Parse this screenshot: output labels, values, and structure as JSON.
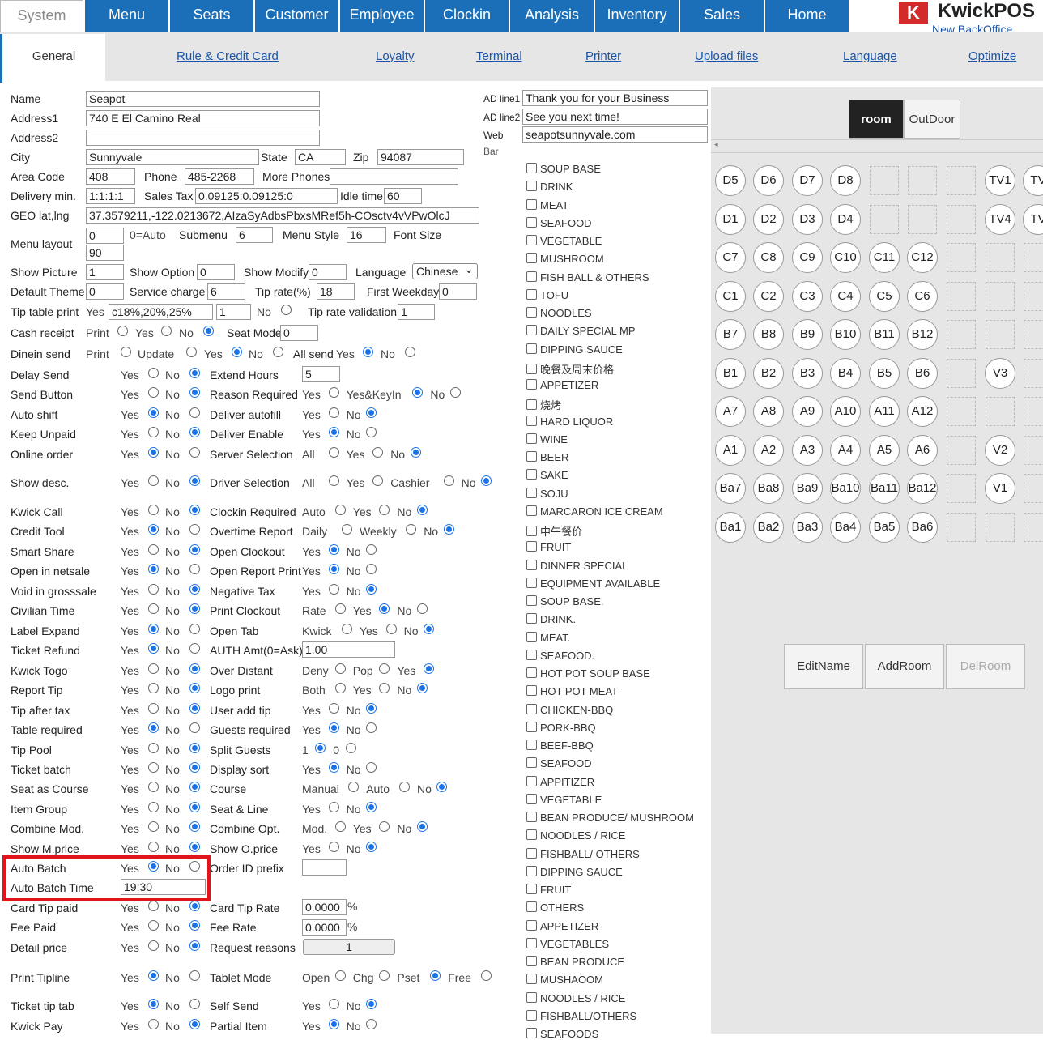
{
  "nav": {
    "system": "System",
    "items": [
      "Menu",
      "Seats",
      "Customer",
      "Employee",
      "Clockin",
      "Analysis",
      "Inventory",
      "Sales",
      "Home"
    ],
    "brand": "KwickPOS",
    "backoffice": "New BackOffice"
  },
  "subnav": {
    "general": "General",
    "links": [
      "Rule & Credit Card",
      "Loyalty",
      "Terminal",
      "Printer",
      "Upload files",
      "Language",
      "Optimize"
    ]
  },
  "form": {
    "name_l": "Name",
    "name_v": "Seapot",
    "addr1_l": "Address1",
    "addr1_v": "740 E El Camino Real",
    "addr2_l": "Address2",
    "addr2_v": "",
    "city_l": "City",
    "city_v": "Sunnyvale",
    "state_l": "State",
    "state_v": "CA",
    "zip_l": "Zip",
    "zip_v": "94087",
    "area_l": "Area Code",
    "area_v": "408",
    "phone_l": "Phone",
    "phone_v": "485-2268",
    "more_l": "More Phones",
    "more_v": "",
    "delivery_l": "Delivery min.",
    "delivery_v": "1:1:1:1",
    "tax_l": "Sales Tax",
    "tax_v": "0.09125:0.09125:0",
    "idle_l": "Idle time",
    "idle_v": "60",
    "geo_l": "GEO lat,lng",
    "geo_v": "37.3579211,-122.0213672,AIzaSyAdbsPbxsMRef5h-COsctv4vVPwOlcJ",
    "menulayout_l": "Menu layout",
    "menulayout_v1": "0",
    "menulayout_t": "0=Auto",
    "menulayout_v2": "90",
    "submenu_l": "Submenu",
    "submenu_v": "6",
    "menustyle_l": "Menu Style",
    "menustyle_v": "16",
    "fontsize_l": "Font Size",
    "showpic_l": "Show Picture",
    "showpic_v": "1",
    "showopt_l": "Show Option",
    "showopt_v": "0",
    "showmod_l": "Show Modify",
    "showmod_v": "0",
    "lang_l": "Language",
    "lang_v": "Chinese",
    "theme_l": "Default Theme",
    "theme_v": "0",
    "svc_l": "Service charge",
    "svc_v": "6",
    "tiprate_l": "Tip rate(%)",
    "tiprate_v": "18",
    "firstwd_l": "First Weekday",
    "firstwd_v": "0",
    "tiptable_l": "Tip table print",
    "tiptable_yes": "Yes",
    "tiptable_v": "c18%,20%,25%",
    "tiptable_v2": "1",
    "tiptable_no": "No",
    "tipval_l": "Tip rate validation",
    "tipval_v": "1",
    "cash_l": "Cash receipt",
    "cash_t1": "Print",
    "cash_t2": "Yes",
    "cash_t3": "No",
    "seatmode_l": "Seat Mode",
    "seatmode_v": "0",
    "dinein_l": "Dinein send",
    "dinein_t1": "Print",
    "dinein_t2": "Update",
    "dinein_t3": "Yes",
    "dinein_t4": "No",
    "allsend_l": "All send",
    "allsend_yes": "Yes",
    "allsend_no": "No",
    "extend_v": "5",
    "authamt_v": "1.00",
    "cardtip_v": "0.0000",
    "feerate_v": "0.0000",
    "pct": "%",
    "reqreason_v": "1",
    "autobatch_v": "19:30",
    "orderid_v": ""
  },
  "rows": [
    {
      "l": "Delay Send",
      "r": "Extend Hours"
    },
    {
      "l": "Send Button",
      "r": "Reason Required",
      "o": [
        "Yes",
        "Yes&KeyIn",
        "No"
      ]
    },
    {
      "l": "Auto shift",
      "r": "Deliver autofill",
      "o": [
        "Yes",
        "No"
      ]
    },
    {
      "l": "Keep Unpaid",
      "r": "Deliver Enable",
      "o": [
        "Yes",
        "No"
      ]
    },
    {
      "l": "Online order",
      "r": "Server Selection",
      "o": [
        "All",
        "Yes",
        "No"
      ]
    },
    {
      "l": "Show desc.",
      "r": "Driver Selection",
      "o": [
        "All",
        "Yes",
        "Cashier",
        "No"
      ]
    },
    {
      "l": "Kwick Call",
      "r": "Clockin Required",
      "o": [
        "Auto",
        "Yes",
        "No"
      ]
    },
    {
      "l": "Credit Tool",
      "r": "Overtime Report",
      "o": [
        "Daily",
        "Weekly",
        "No"
      ]
    },
    {
      "l": "Smart Share",
      "r": "Open Clockout",
      "o": [
        "Yes",
        "No"
      ]
    },
    {
      "l": "Open in netsale",
      "r": "Open Report Print",
      "o": [
        "Yes",
        "No"
      ]
    },
    {
      "l": "Void in grosssale",
      "r": "Negative Tax",
      "o": [
        "Yes",
        "No"
      ]
    },
    {
      "l": "Civilian Time",
      "r": "Print Clockout",
      "o": [
        "Rate",
        "Yes",
        "No"
      ]
    },
    {
      "l": "Label Expand",
      "r": "Open Tab",
      "o": [
        "Kwick",
        "Yes",
        "No"
      ]
    },
    {
      "l": "Ticket Refund",
      "r": "AUTH Amt(0=Ask)"
    },
    {
      "l": "Kwick Togo",
      "r": "Over Distant",
      "o": [
        "Deny",
        "Pop",
        "Yes"
      ]
    },
    {
      "l": "Report Tip",
      "r": "Logo print",
      "o": [
        "Both",
        "Yes",
        "No"
      ]
    },
    {
      "l": "Tip after tax",
      "r": "User add tip",
      "o": [
        "Yes",
        "No"
      ]
    },
    {
      "l": "Table required",
      "r": "Guests required",
      "o": [
        "Yes",
        "No"
      ]
    },
    {
      "l": "Tip Pool",
      "r": "Split Guests",
      "o": [
        "1",
        "0"
      ]
    },
    {
      "l": "Ticket batch",
      "r": "Display sort",
      "o": [
        "Yes",
        "No"
      ]
    },
    {
      "l": "Seat as Course",
      "r": "Course",
      "o": [
        "Manual",
        "Auto",
        "No"
      ]
    },
    {
      "l": "Item Group",
      "r": "Seat & Line",
      "o": [
        "Yes",
        "No"
      ]
    },
    {
      "l": "Combine Mod.",
      "r": "Combine Opt.",
      "o": [
        "Mod.",
        "Yes",
        "No"
      ]
    },
    {
      "l": "Show M.price",
      "r": "Show O.price",
      "o": [
        "Yes",
        "No"
      ]
    },
    {
      "l": "Auto Batch",
      "r": "Order ID prefix"
    },
    {
      "l": "Auto Batch Time",
      "r": ""
    },
    {
      "l": "Card Tip paid",
      "r": "Card Tip Rate"
    },
    {
      "l": "Fee Paid",
      "r": "Fee Rate"
    },
    {
      "l": "Detail price",
      "r": "Request reasons"
    },
    {
      "l": "Print Tipline",
      "r": "Tablet Mode",
      "o": [
        "Open",
        "Chg",
        "Pset",
        "Free"
      ]
    },
    {
      "l": "Ticket tip tab",
      "r": "Self Send",
      "o": [
        "Yes",
        "No"
      ]
    },
    {
      "l": "Kwick Pay",
      "r": "Partial Item",
      "o": [
        "Yes",
        "No"
      ]
    }
  ],
  "yes": "Yes",
  "no": "No",
  "ad": {
    "l1": "AD line1",
    "v1": "Thank you for your Business",
    "l2": "AD line2",
    "v2": "See you next time!",
    "web_l": "Web",
    "web_v": "seapotsunnyvale.com",
    "bar": "Bar"
  },
  "categories": [
    "SOUP BASE",
    "DRINK",
    "MEAT",
    "SEAFOOD",
    "VEGETABLE",
    "MUSHROOM",
    "FISH BALL & OTHERS",
    "TOFU",
    "NOODLES",
    "DAILY SPECIAL MP",
    "DIPPING SAUCE",
    "晚餐及周末价格",
    "APPETIZER",
    "烧烤",
    "HARD LIQUOR",
    "WINE",
    "BEER",
    "SAKE",
    "SOJU",
    "MARCARON ICE CREAM",
    "中午餐价",
    "FRUIT",
    "DINNER SPECIAL",
    "EQUIPMENT AVAILABLE",
    "SOUP BASE.",
    "DRINK.",
    "MEAT.",
    "SEAFOOD.",
    "HOT POT SOUP BASE",
    "HOT POT MEAT",
    "CHICKEN-BBQ",
    "PORK-BBQ",
    "BEEF-BBQ",
    "SEAFOOD",
    "APPITIZER",
    "VEGETABLE",
    "BEAN PRODUCE/ MUSHROOM",
    "NOODLES / RICE",
    "FISHBALL/ OTHERS",
    "DIPPING SAUCE",
    "FRUIT",
    "OTHERS",
    "APPETIZER",
    "VEGETABLES",
    "BEAN PRODUCE",
    "MUSHAOOM",
    "NOODLES / RICE",
    "FISHBALL/OTHERS",
    "SEAFOODS"
  ],
  "rooms": {
    "room": "room",
    "outdoor": "OutDoor"
  },
  "tables": [
    [
      "D5",
      "D6",
      "D7",
      "D8",
      "",
      "",
      "",
      "TV1",
      "TV"
    ],
    [
      "D1",
      "D2",
      "D3",
      "D4",
      "",
      "",
      "",
      "TV4",
      "TV"
    ],
    [
      "C7",
      "C8",
      "C9",
      "C10",
      "C11",
      "C12",
      "",
      "",
      ""
    ],
    [
      "C1",
      "C2",
      "C3",
      "C4",
      "C5",
      "C6",
      "",
      "",
      ""
    ],
    [
      "B7",
      "B8",
      "B9",
      "B10",
      "B11",
      "B12",
      "",
      "",
      ""
    ],
    [
      "B1",
      "B2",
      "B3",
      "B4",
      "B5",
      "B6",
      "",
      "V3",
      ""
    ],
    [
      "A7",
      "A8",
      "A9",
      "A10",
      "A11",
      "A12",
      "",
      "",
      ""
    ],
    [
      "A1",
      "A2",
      "A3",
      "A4",
      "A5",
      "A6",
      "",
      "V2",
      ""
    ],
    [
      "Ba7",
      "Ba8",
      "Ba9",
      "Ba10",
      "Ba11",
      "Ba12",
      "",
      "V1",
      ""
    ],
    [
      "Ba1",
      "Ba2",
      "Ba3",
      "Ba4",
      "Ba5",
      "Ba6",
      "",
      "",
      ""
    ]
  ],
  "actions": {
    "edit": "EditName",
    "add": "AddRoom",
    "del": "DelRoom"
  },
  "colors": {
    "nav": "#1a6fb8",
    "highlight": "#e0141a",
    "radio": "#1a73e8"
  }
}
